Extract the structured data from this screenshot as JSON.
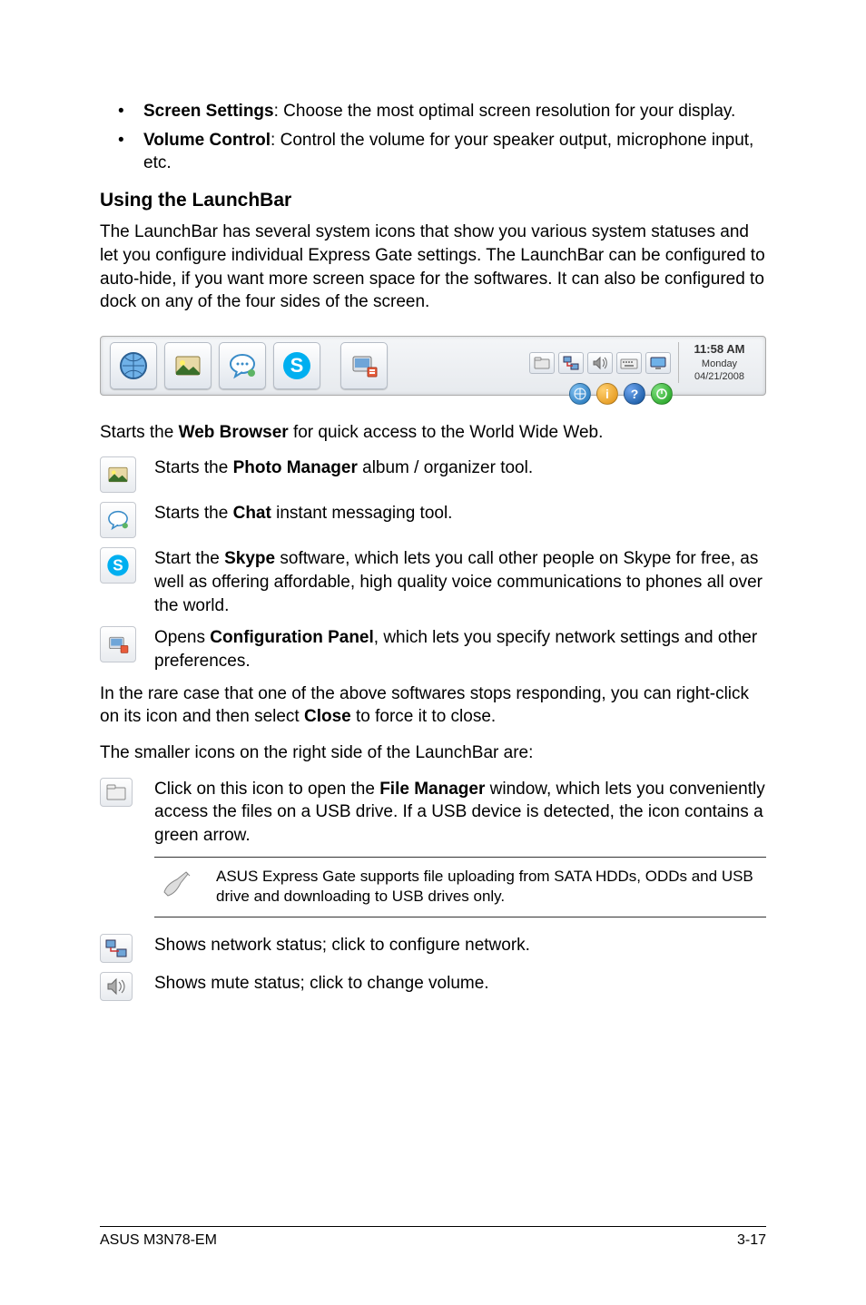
{
  "bullets": {
    "screen_title": "Screen Settings",
    "screen_text": ": Choose the most optimal screen resolution for your display.",
    "volume_title": "Volume Control",
    "volume_text": ": Control the volume for your speaker output, microphone input, etc."
  },
  "heading_using": "Using the LaunchBar",
  "para_using": "The LaunchBar has several system icons that show you various system statuses and let you configure individual Express Gate settings. The LaunchBar can be configured to auto-hide, if you want more screen space for the softwares. It can also be configured to dock on any of the four sides of the screen.",
  "clock": {
    "time": "11:58 AM",
    "day": "Monday",
    "date": "04/21/2008"
  },
  "start_web_a": "Starts the ",
  "start_web_b": "Web Browser",
  "start_web_c": " for quick access to the World Wide Web.",
  "photo_a": "Starts the ",
  "photo_b": "Photo Manager",
  "photo_c": " album / organizer tool.",
  "chat_a": "Starts the ",
  "chat_b": "Chat",
  "chat_c": " instant messaging tool.",
  "skype_a": "Start the ",
  "skype_b": "Skype",
  "skype_c": " software, which lets you call other people on Skype for free, as well as offering affordable, high quality voice communications to phones all over the world.",
  "conf_a": "Opens ",
  "conf_b": "Configuration Panel",
  "conf_c": ", which lets you specify network settings and other preferences.",
  "rare_a": "In the rare case that one of the above softwares stops responding, you can right-click on its icon and then select ",
  "rare_b": "Close",
  "rare_c": " to force it to close.",
  "smaller": "The smaller icons on the right side of the LaunchBar are:",
  "file_a": "Click on this icon to open the ",
  "file_b": "File Manager",
  "file_c": " window, which lets you conveniently access the files on a USB drive. If a USB device is detected, the icon contains a green arrow.",
  "note_text": "ASUS Express Gate supports file uploading from SATA HDDs, ODDs and USB drive and downloading to USB drives only.",
  "network": "Shows network status; click to configure network.",
  "mute": "Shows mute status; click to change volume.",
  "footer_left": "ASUS M3N78-EM",
  "footer_right": "3-17"
}
